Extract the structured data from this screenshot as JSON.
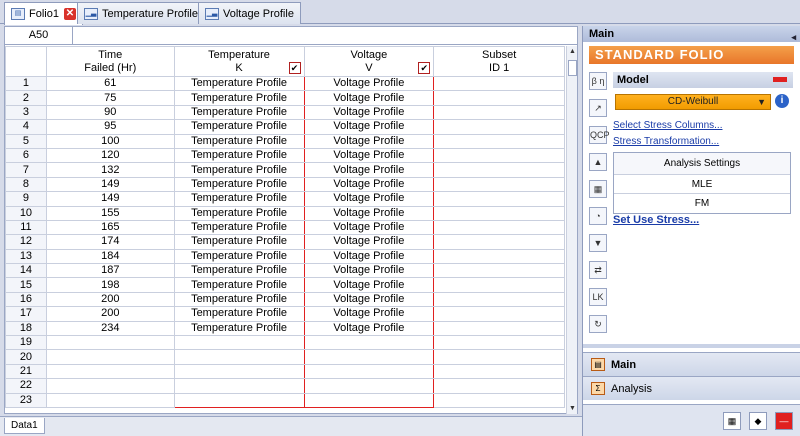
{
  "tabs": [
    {
      "label": "Folio1",
      "icon": "folio-icon",
      "closable": true
    },
    {
      "label": "Temperature Profile",
      "icon": "profile-chart-icon"
    },
    {
      "label": "Voltage Profile",
      "icon": "profile-chart-icon"
    }
  ],
  "sheet": {
    "cell_ref": "A50",
    "headers": [
      {
        "line1": "Time",
        "line2": "Failed (Hr)"
      },
      {
        "line1": "Temperature",
        "line2": "K"
      },
      {
        "line1": "Voltage",
        "line2": "V"
      },
      {
        "line1": "Subset",
        "line2": "ID 1"
      }
    ],
    "rows": [
      {
        "n": "1",
        "time": "61",
        "temp": "Temperature Profile",
        "volt": "Voltage Profile"
      },
      {
        "n": "2",
        "time": "75",
        "temp": "Temperature Profile",
        "volt": "Voltage Profile"
      },
      {
        "n": "3",
        "time": "90",
        "temp": "Temperature Profile",
        "volt": "Voltage Profile"
      },
      {
        "n": "4",
        "time": "95",
        "temp": "Temperature Profile",
        "volt": "Voltage Profile"
      },
      {
        "n": "5",
        "time": "100",
        "temp": "Temperature Profile",
        "volt": "Voltage Profile"
      },
      {
        "n": "6",
        "time": "120",
        "temp": "Temperature Profile",
        "volt": "Voltage Profile"
      },
      {
        "n": "7",
        "time": "132",
        "temp": "Temperature Profile",
        "volt": "Voltage Profile"
      },
      {
        "n": "8",
        "time": "149",
        "temp": "Temperature Profile",
        "volt": "Voltage Profile"
      },
      {
        "n": "9",
        "time": "149",
        "temp": "Temperature Profile",
        "volt": "Voltage Profile"
      },
      {
        "n": "10",
        "time": "155",
        "temp": "Temperature Profile",
        "volt": "Voltage Profile"
      },
      {
        "n": "11",
        "time": "165",
        "temp": "Temperature Profile",
        "volt": "Voltage Profile"
      },
      {
        "n": "12",
        "time": "174",
        "temp": "Temperature Profile",
        "volt": "Voltage Profile"
      },
      {
        "n": "13",
        "time": "184",
        "temp": "Temperature Profile",
        "volt": "Voltage Profile"
      },
      {
        "n": "14",
        "time": "187",
        "temp": "Temperature Profile",
        "volt": "Voltage Profile"
      },
      {
        "n": "15",
        "time": "198",
        "temp": "Temperature Profile",
        "volt": "Voltage Profile"
      },
      {
        "n": "16",
        "time": "200",
        "temp": "Temperature Profile",
        "volt": "Voltage Profile"
      },
      {
        "n": "17",
        "time": "200",
        "temp": "Temperature Profile",
        "volt": "Voltage Profile"
      },
      {
        "n": "18",
        "time": "234",
        "temp": "Temperature Profile",
        "volt": "Voltage Profile"
      },
      {
        "n": "19",
        "time": "",
        "temp": "",
        "volt": ""
      },
      {
        "n": "20",
        "time": "",
        "temp": "",
        "volt": ""
      },
      {
        "n": "21",
        "time": "",
        "temp": "",
        "volt": ""
      },
      {
        "n": "22",
        "time": "",
        "temp": "",
        "volt": ""
      },
      {
        "n": "23",
        "time": "",
        "temp": "",
        "volt": ""
      }
    ],
    "sheet_tab": "Data1"
  },
  "panel": {
    "title": "Main",
    "banner": "Standard Folio",
    "model_label": "Model",
    "model_value": "CD-Weibull",
    "link_stress_columns": "Select Stress Columns...",
    "link_stress_transform": "Stress Transformation...",
    "analysis_settings_title": "Analysis Settings",
    "analysis_method": "MLE",
    "ranking_method": "FM",
    "link_use_stress": "Set Use Stress...",
    "nav_main": "Main",
    "nav_analysis": "Analysis",
    "tool_labels": [
      "β η",
      "↗",
      "QCP",
      "▲",
      "▦",
      "◔",
      "▼",
      "⇄",
      "LK",
      "↻"
    ]
  },
  "colors": {
    "accent_orange": "#f29c00",
    "profile_border": "#e02020",
    "link": "#1a3ca8"
  }
}
